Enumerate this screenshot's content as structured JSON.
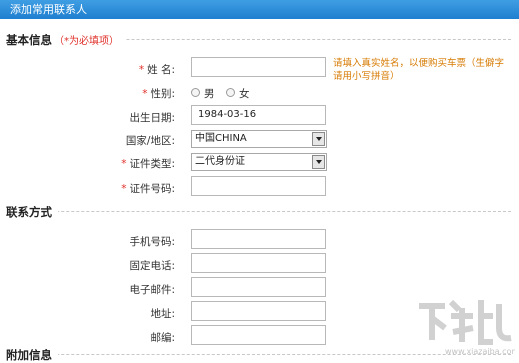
{
  "window": {
    "title": "添加常用联系人"
  },
  "basic": {
    "title": "基本信息",
    "note": "（*为必填项）",
    "name_label": "姓  名:",
    "name_value": "",
    "name_hint": "请填入真实姓名，以便购买车票（生僻字请用小写拼音）",
    "gender_label": "性别:",
    "gender_options": [
      "男",
      "女"
    ],
    "birth_label": "出生日期:",
    "birth_value": "1984-03-16",
    "country_label": "国家/地区:",
    "country_value": "中国CHINA",
    "idtype_label": "证件类型:",
    "idtype_value": "二代身份证",
    "idno_label": "证件号码:",
    "idno_value": ""
  },
  "contact": {
    "title": "联系方式",
    "mobile_label": "手机号码:",
    "phone_label": "固定电话:",
    "email_label": "电子邮件:",
    "address_label": "地址:",
    "zip_label": "邮编:"
  },
  "extra": {
    "title": "附加信息"
  },
  "required_mark": "*",
  "watermark": {
    "text": "下载吧",
    "url": "www.xiazaiba.com"
  }
}
